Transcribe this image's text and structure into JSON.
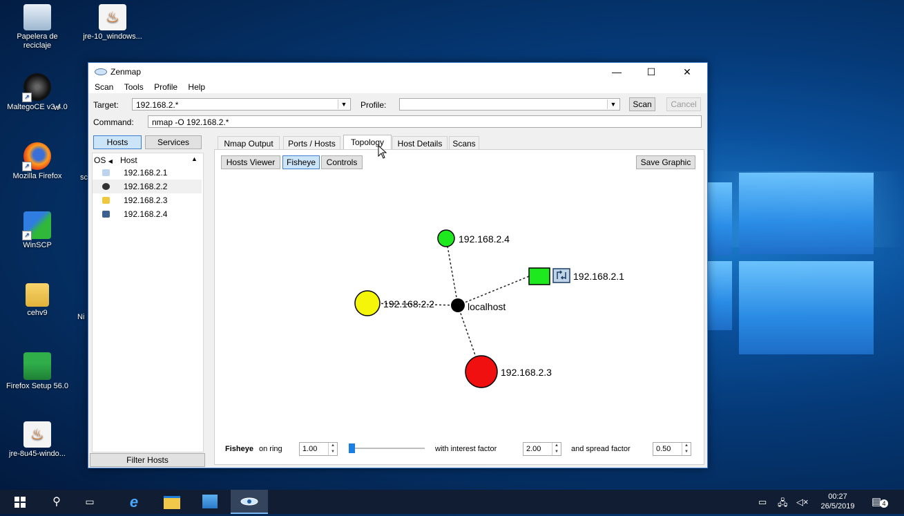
{
  "desktop": {
    "icons": [
      {
        "label": "Papelera de reciclaje"
      },
      {
        "label": "jre-10_windows..."
      },
      {
        "label": "MaltegoCE v3.4.0"
      },
      {
        "label": "w"
      },
      {
        "label": "Mozilla Firefox"
      },
      {
        "label": "sc"
      },
      {
        "label": "WinSCP"
      },
      {
        "label": "cehv9"
      },
      {
        "label": "Ni"
      },
      {
        "label": "Firefox Setup 56.0"
      },
      {
        "label": "jre-8u45-windo..."
      }
    ]
  },
  "window": {
    "title": "Zenmap",
    "menu": [
      "Scan",
      "Tools",
      "Profile",
      "Help"
    ],
    "target_label": "Target:",
    "target_value": "192.168.2.*",
    "profile_label": "Profile:",
    "profile_value": "",
    "scan_button": "Scan",
    "cancel_button": "Cancel",
    "command_label": "Command:",
    "command_value": "nmap -O 192.168.2.*",
    "left_panel": {
      "hosts_tab": "Hosts",
      "services_tab": "Services",
      "col_os": "OS",
      "col_host": "Host",
      "hosts": [
        "192.168.2.1",
        "192.168.2.2",
        "192.168.2.3",
        "192.168.2.4"
      ],
      "filter_button": "Filter Hosts"
    },
    "tabs": [
      "Nmap Output",
      "Ports / Hosts",
      "Topology",
      "Host Details",
      "Scans"
    ],
    "active_tab": "Topology",
    "topology": {
      "hosts_viewer": "Hosts Viewer",
      "fisheye": "Fisheye",
      "controls": "Controls",
      "save_graphic": "Save Graphic",
      "nodes": {
        "center": "localhost",
        "n1": "192.168.2.1",
        "n2": "192.168.2.2",
        "n3": "192.168.2.3",
        "n4": "192.168.2.4"
      },
      "colors": {
        "green": "#1ee81e",
        "yellow": "#f5f50a",
        "red": "#f01010"
      },
      "fisheye_label": "Fisheye",
      "on_ring_label": "on ring",
      "ring_value": "1.00",
      "ring_slider_fraction": 0.0,
      "interest_label": "with interest factor",
      "interest_value": "2.00",
      "spread_label": "and spread factor",
      "spread_value": "0.50"
    }
  },
  "taskbar": {
    "time": "00:27",
    "date": "26/5/2019",
    "notifications": "4"
  }
}
